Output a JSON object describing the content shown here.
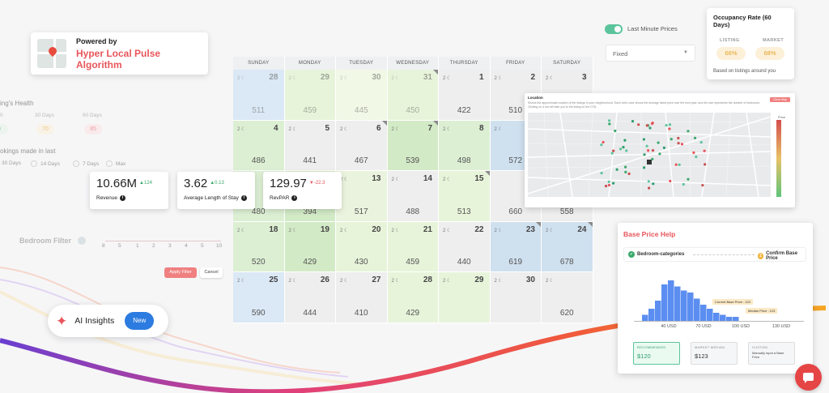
{
  "powered": {
    "small": "Powered by",
    "big": "Hyper Local Pulse Algorithm"
  },
  "left_panel": {
    "health_title": "ing's Health",
    "cols": [
      "0",
      "30 Days",
      "60 Days"
    ],
    "badges": [
      "0",
      "70",
      "85"
    ],
    "bookings_title": "okings made in last",
    "radios": [
      "30 Days",
      "14 Days",
      "7 Days",
      "Max"
    ],
    "bedroom_filter": "Bedroom Filter",
    "bedroom_ticks": [
      "8",
      "5",
      "1",
      "2",
      "3",
      "4",
      "5",
      "10"
    ],
    "apply": "Apply Filter",
    "cancel": "Cancel"
  },
  "calendar": {
    "days": [
      "SUNDAY",
      "MONDAY",
      "TUESDAY",
      "WEDNESDAY",
      "THURSDAY",
      "FRIDAY",
      "SATURDAY"
    ],
    "cells": [
      {
        "meta": "2 ☾",
        "day": "28",
        "price": "511",
        "color": "#dbe8f5",
        "faded": true
      },
      {
        "meta": "2 ☾",
        "day": "29",
        "price": "459",
        "color": "#e8f4da",
        "faded": true
      },
      {
        "meta": "2 ☾",
        "day": "30",
        "price": "445",
        "color": "#f1f8e6",
        "faded": true
      },
      {
        "meta": "2 ☾",
        "day": "31",
        "price": "450",
        "color": "#e8f4da",
        "faded": true
      },
      {
        "meta": "2 ☾",
        "day": "1",
        "price": "422",
        "color": "#eeeeee",
        "faded": false
      },
      {
        "meta": "2 ☾",
        "day": "2",
        "price": "510",
        "color": "#eeeeee",
        "faded": false
      },
      {
        "meta": "2 ☾",
        "day": "3",
        "price": "",
        "color": "#eeeeee",
        "faded": false
      },
      {
        "meta": "2 ☾",
        "day": "4",
        "price": "486",
        "color": "#dcefd3",
        "faded": false
      },
      {
        "meta": "2 ☾",
        "day": "5",
        "price": "441",
        "color": "#eeeeee",
        "faded": false
      },
      {
        "meta": "2 ☾",
        "day": "6",
        "price": "467",
        "color": "#eeeeee",
        "faded": false
      },
      {
        "meta": "2 ☾",
        "day": "7",
        "price": "539",
        "color": "#d2eac6",
        "faded": false
      },
      {
        "meta": "2 ☾",
        "day": "8",
        "price": "498",
        "color": "#dcefd3",
        "faded": false
      },
      {
        "meta": "2 ☾",
        "day": "",
        "price": "572",
        "color": "#cfe0ef",
        "faded": false
      },
      {
        "meta": "",
        "day": "",
        "price": "",
        "color": "#eeeeee",
        "faded": false
      },
      {
        "meta": "",
        "day": "",
        "price": "480",
        "color": "#dcefd3",
        "faded": false
      },
      {
        "meta": "",
        "day": "",
        "price": "394",
        "color": "#d2eac6",
        "faded": false
      },
      {
        "meta": "2 ☾",
        "day": "13",
        "price": "517",
        "color": "#eaf3dd",
        "faded": false
      },
      {
        "meta": "2 ☾",
        "day": "14",
        "price": "488",
        "color": "#eeeeee",
        "faded": false
      },
      {
        "meta": "2 ☾",
        "day": "15",
        "price": "513",
        "color": "#e8f4da",
        "faded": false
      },
      {
        "meta": "",
        "day": "",
        "price": "660",
        "color": "#eeeeee",
        "faded": false
      },
      {
        "meta": "",
        "day": "",
        "price": "558",
        "color": "#eeeeee",
        "faded": false
      },
      {
        "meta": "2 ☾",
        "day": "18",
        "price": "520",
        "color": "#dcefd3",
        "faded": false
      },
      {
        "meta": "2 ☾",
        "day": "19",
        "price": "429",
        "color": "#d2eac6",
        "faded": false
      },
      {
        "meta": "2 ☾",
        "day": "20",
        "price": "430",
        "color": "#e8f4da",
        "faded": false
      },
      {
        "meta": "2 ☾",
        "day": "21",
        "price": "459",
        "color": "#e8f4da",
        "faded": false
      },
      {
        "meta": "2 ☾",
        "day": "22",
        "price": "440",
        "color": "#eeeeee",
        "faded": false
      },
      {
        "meta": "2 ☾",
        "day": "23",
        "price": "619",
        "color": "#cfe0ef",
        "faded": false
      },
      {
        "meta": "2 ☾",
        "day": "24",
        "price": "678",
        "color": "#cfe0ef",
        "faded": false
      },
      {
        "meta": "2 ☾",
        "day": "25",
        "price": "590",
        "color": "#dbe8f5",
        "faded": false
      },
      {
        "meta": "2 ☾",
        "day": "26",
        "price": "444",
        "color": "#eeeeee",
        "faded": false
      },
      {
        "meta": "2 ☾",
        "day": "27",
        "price": "410",
        "color": "#eeeeee",
        "faded": false
      },
      {
        "meta": "2 ☾",
        "day": "28",
        "price": "429",
        "color": "#e8f4da",
        "faded": false
      },
      {
        "meta": "2 ☾",
        "day": "29",
        "price": "",
        "color": "#e8f4da",
        "faded": false
      },
      {
        "meta": "2 ☾",
        "day": "30",
        "price": "",
        "color": "#eeeeee",
        "faded": false
      },
      {
        "meta": "2 ☾",
        "day": "",
        "price": "620",
        "color": "#eeeeee",
        "faded": false
      }
    ]
  },
  "metrics": [
    {
      "value": "10.66M",
      "delta": "▲124",
      "delta_color": "#3aa86b",
      "label": "Revenue"
    },
    {
      "value": "3.62",
      "delta": "▲0.13",
      "delta_color": "#3aa86b",
      "label": "Average Length of Stay"
    },
    {
      "value": "129.97",
      "delta": "▼-22.3",
      "delta_color": "#e8555b",
      "label": "RevPAR"
    }
  ],
  "top_right": {
    "toggle_label": "Last Minute Prices",
    "select_value": "Fixed"
  },
  "occupancy": {
    "title": "Occupancy Rate (60 Days)",
    "listing_label": "LISTING",
    "market_label": "MARKET",
    "listing_value": "66%",
    "market_value": "68%",
    "footer": "Based on listings around you"
  },
  "map": {
    "title": "Location",
    "desc": "Shows the approximate location of the listings in your neighborhood. Each dot's color shows the average listed price over the next year, and the size represents the number of bedrooms. Clicking on a dot will take you to the listing on the OTA.",
    "close": "Close Map",
    "scale_label": "Price"
  },
  "base_price": {
    "title": "Base Price Help",
    "step1": "Bedroom-categories",
    "step2": "Confirm Base Price",
    "step2_num": "2",
    "hist_values": [
      3,
      6,
      10,
      18,
      20,
      17,
      15,
      14,
      11,
      8,
      6,
      4,
      3,
      2,
      2
    ],
    "ticks": [
      "40 USD",
      "70 USD",
      "100 USD",
      "130 USD"
    ],
    "tip_current": "Current Base Price : 120",
    "tip_median": "Median Price : 123",
    "recommended_label": "RECOMMENDED",
    "recommended_value": "$120",
    "market_label": "MARKET MEDIAN",
    "market_value": "$123",
    "custom_label": "CUSTOM",
    "custom_desc": "Manually input a Base Price"
  },
  "ai": {
    "label": "AI Insights",
    "new": "New"
  },
  "colors": {
    "accent": "#e8555b",
    "blue": "#2c7be0",
    "green": "#5cc49c"
  }
}
